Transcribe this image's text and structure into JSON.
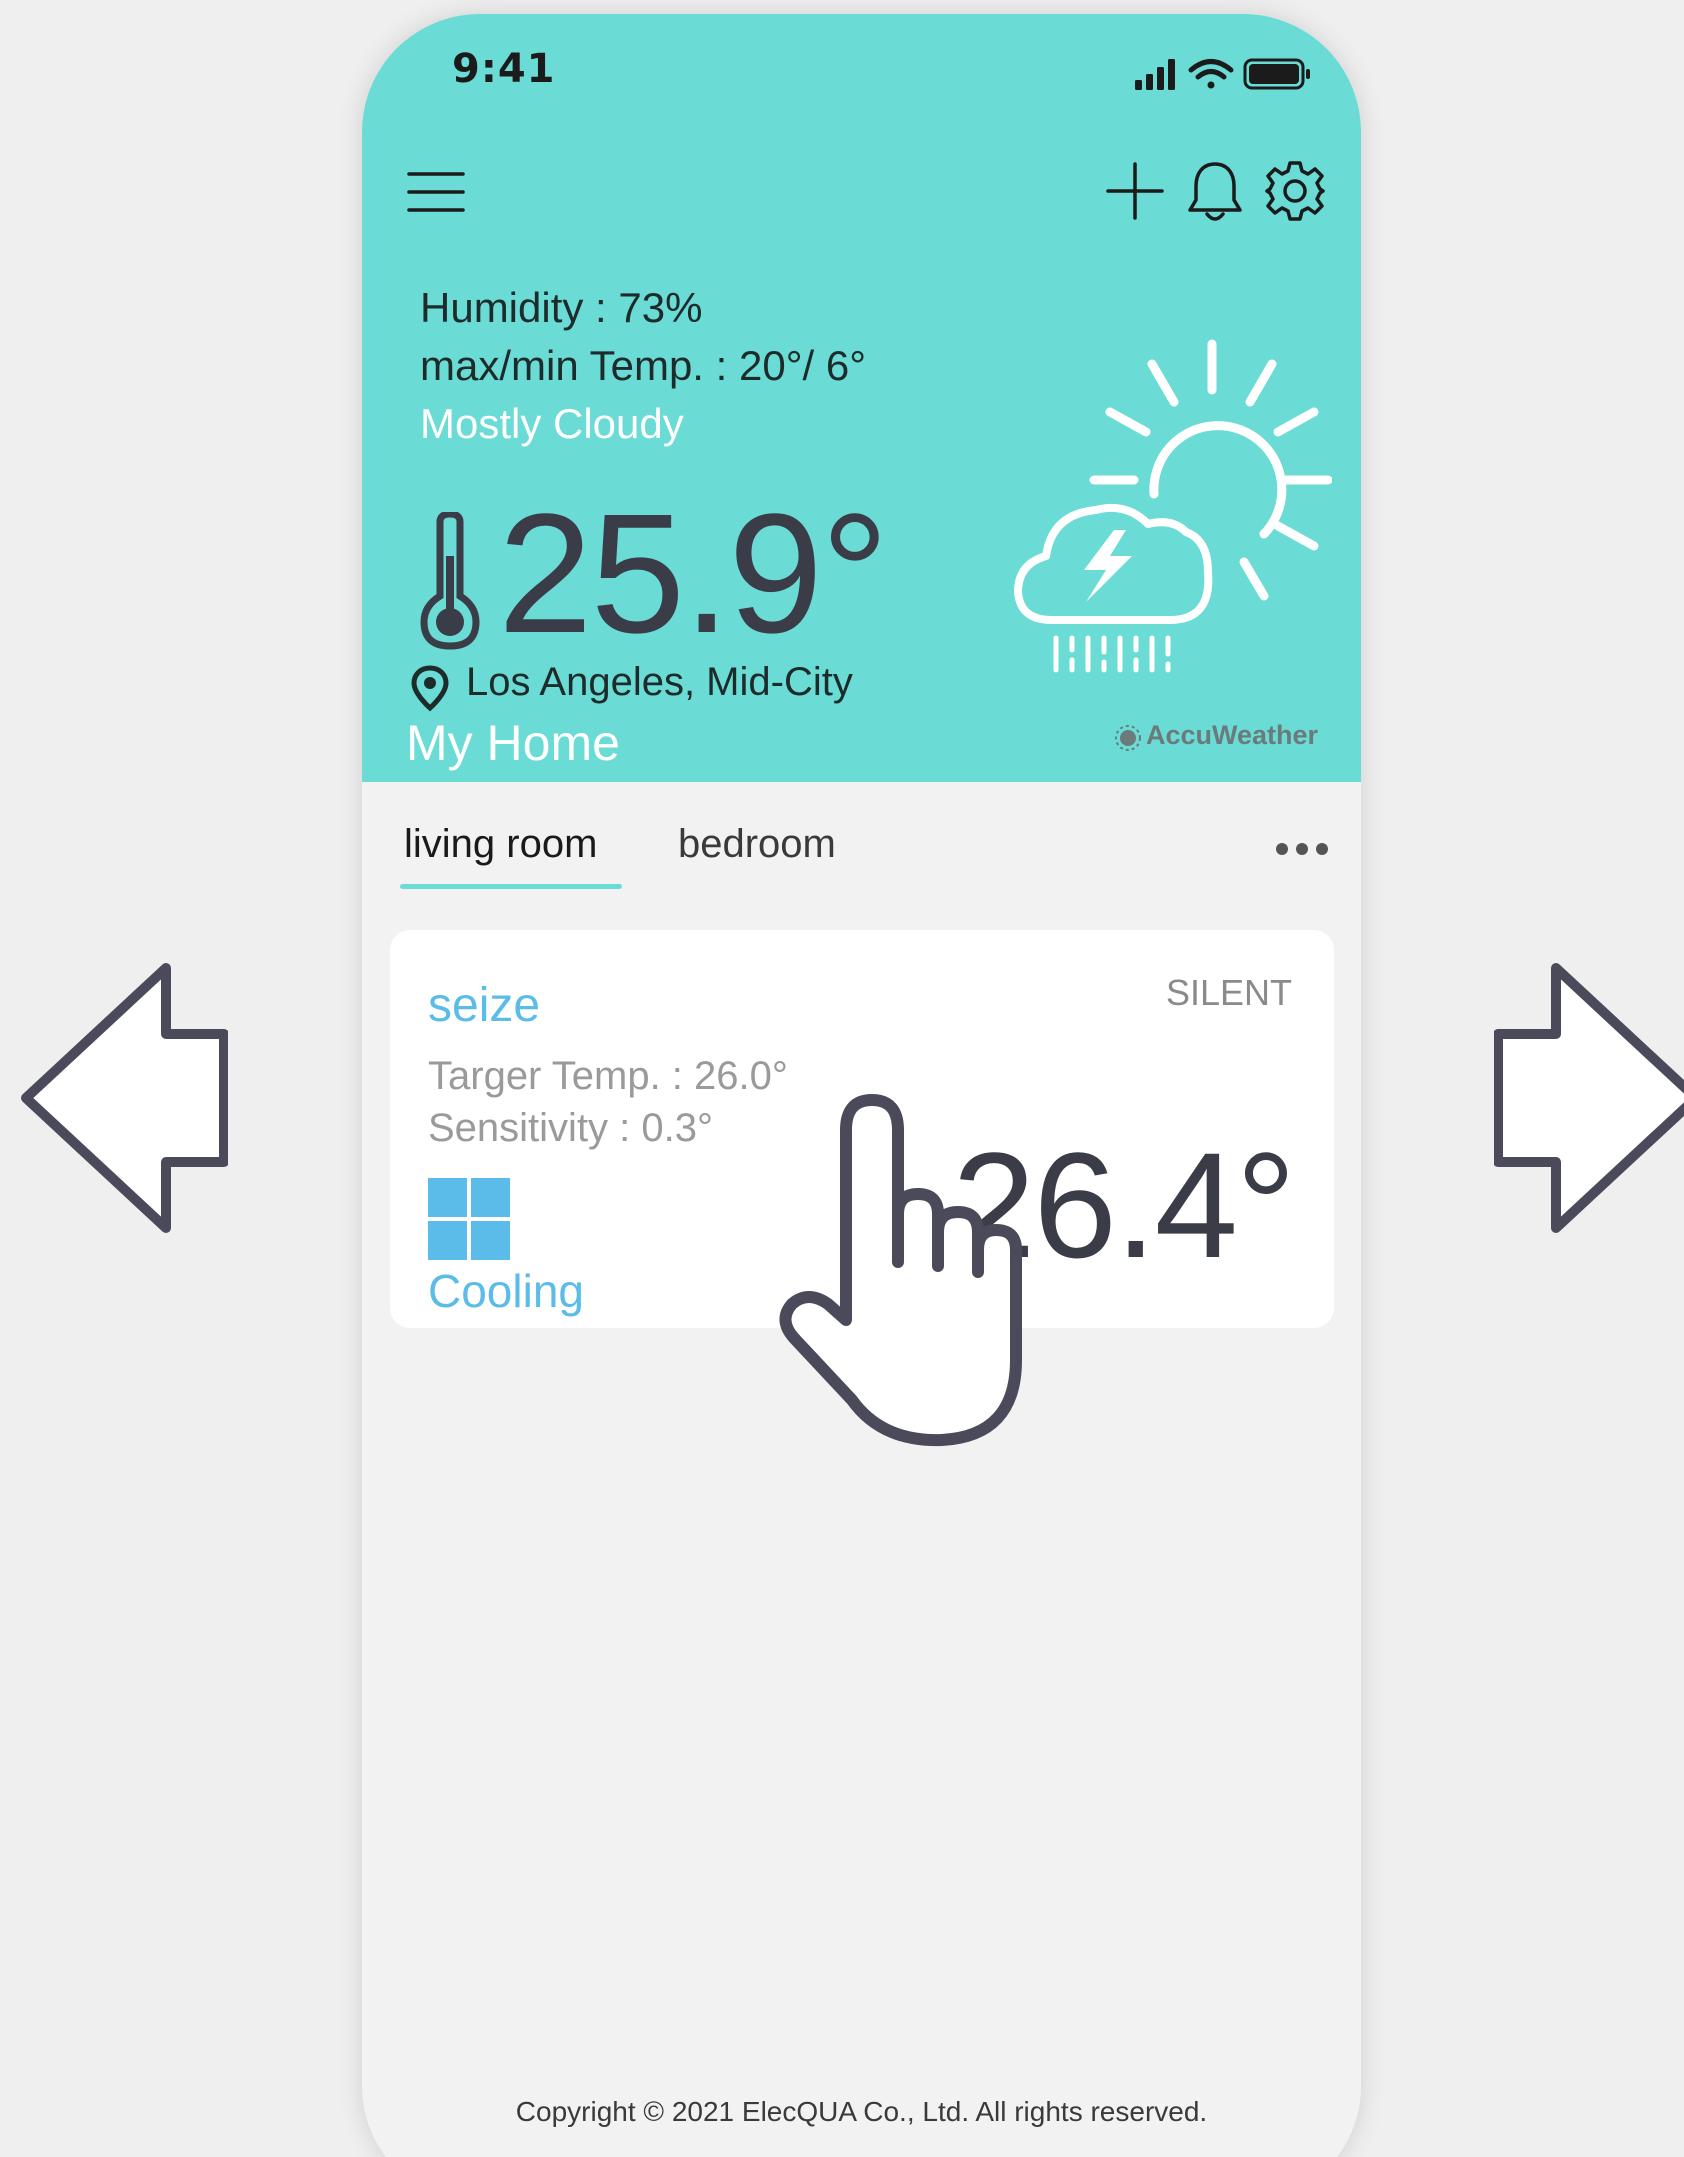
{
  "status_bar": {
    "time": "9:41",
    "icons": [
      "signal-icon",
      "wifi-icon",
      "battery-icon"
    ]
  },
  "header": {
    "icons": [
      "hamburger-menu-icon",
      "add-icon",
      "bell-icon",
      "gear-icon"
    ]
  },
  "weather": {
    "humidity": "Humidity : 73%",
    "max_min_temp": "max/min Temp. : 20°/ 6°",
    "condition": "Mostly Cloudy",
    "temperature": "25.9°",
    "location": "Los Angeles, Mid-City",
    "home_name": "My Home",
    "provider": "AccuWeather",
    "icon": "sun-behind-thunder-cloud-icon"
  },
  "tabs": [
    {
      "label": "living room",
      "active": true
    },
    {
      "label": "bedroom",
      "active": false
    }
  ],
  "device_card": {
    "name": "seize",
    "mode": "SILENT",
    "target_temp": "Targer Temp. : 26.0°",
    "sensitivity": "Sensitivity : 0.3°",
    "state": "Cooling",
    "current_temp": "26.4°"
  },
  "footer": {
    "copyright": "Copyright © 2021 ElecQUA Co., Ltd. All rights reserved."
  },
  "colors": {
    "header_bg": "#6adbd5",
    "accent_blue": "#5bbcea",
    "card_bg": "#ffffff",
    "page_bg": "#f2f2f2",
    "dark_text": "#3a3d47"
  }
}
